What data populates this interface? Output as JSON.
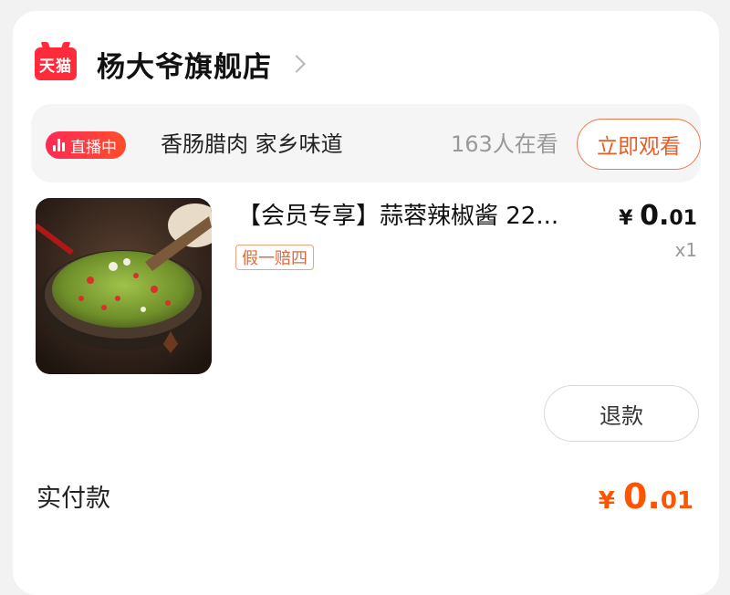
{
  "store": {
    "logo_text": "天猫",
    "name": "杨大爷旗舰店"
  },
  "live": {
    "badge": "直播中",
    "title": "香肠腊肉 家乡味道",
    "viewers": "163人在看",
    "watch_label": "立即观看"
  },
  "product": {
    "title": "【会员专享】蒜蓉辣椒酱 22...",
    "tag": "假一赔四",
    "currency": "¥",
    "price_int": "0.",
    "price_dec": "01",
    "quantity": "x1",
    "refund_label": "退款"
  },
  "payment": {
    "label": "实付款",
    "currency": "¥",
    "amount_int": "0.",
    "amount_dec": "01"
  },
  "colors": {
    "accent": "#ff5500",
    "tmall_red": "#ff2a3a",
    "watch_orange": "#e4602a"
  }
}
